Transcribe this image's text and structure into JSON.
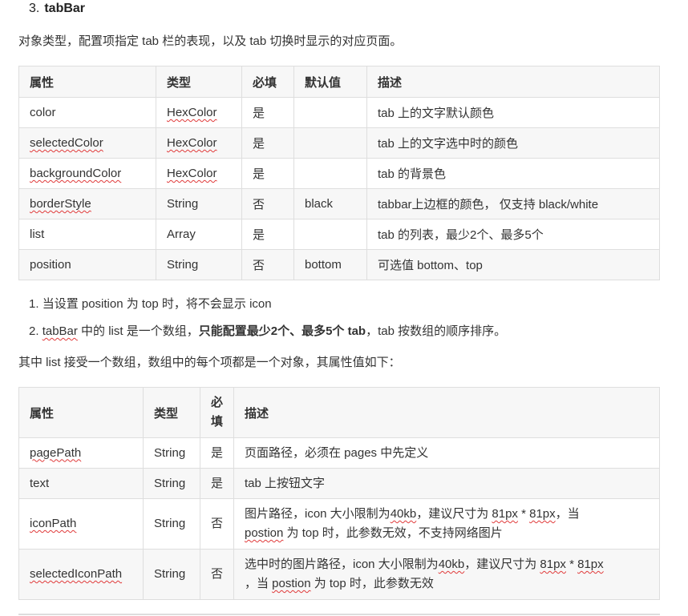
{
  "heading": {
    "number": "3.",
    "title": "tabBar"
  },
  "intro": "对象类型，配置项指定 tab 栏的表现，以及 tab 切换时显示的对应页面。",
  "table1": {
    "headers": [
      "属性",
      "类型",
      "必填",
      "默认值",
      "描述"
    ],
    "rows": [
      [
        "color",
        "HexColor",
        "是",
        "",
        "tab 上的文字默认颜色"
      ],
      [
        "selectedColor",
        "HexColor",
        "是",
        "",
        "tab 上的文字选中时的颜色"
      ],
      [
        "backgroundColor",
        "HexColor",
        "是",
        "",
        "tab 的背景色"
      ],
      [
        "borderStyle",
        "String",
        "否",
        "black",
        "tabbar上边框的颜色， 仅支持 black/white"
      ],
      [
        "list",
        "Array",
        "是",
        "",
        "tab 的列表，最少2个、最多5个"
      ],
      [
        "position",
        "String",
        "否",
        "bottom",
        "可选值 bottom、top"
      ]
    ]
  },
  "notes": {
    "n1_num": "1.",
    "n1": "当设置 position 为 top 时，将不会显示 icon",
    "n2_num": "2.",
    "n2_a": "tabBar",
    "n2_b": " 中的 list 是一个数组，",
    "n2_bold": "只能配置最少2个、最多5个 tab",
    "n2_c": "，tab 按数组的顺序排序。"
  },
  "para2": "其中 list 接受一个数组，数组中的每个项都是一个对象，其属性值如下：",
  "table2": {
    "headers": [
      "属性",
      "类型",
      "必",
      "填",
      "描述"
    ],
    "rows": [
      [
        "pagePath",
        "String",
        "是",
        "页面路径，必须在 pages 中先定义"
      ],
      [
        "text",
        "String",
        "是",
        "tab 上按钮文字"
      ],
      [
        "iconPath",
        "String",
        "否",
        "图片路径，icon 大小限制为",
        "40kb",
        "，建议尺寸为 ",
        "81px",
        " * ",
        "81px",
        "，当",
        "postion",
        " 为 top 时，此参数无效，不支持网络图片"
      ],
      [
        "selectedIconPath",
        "String",
        "否",
        "选中时的图片路径，icon 大小限制为",
        "40kb",
        "，建议尺寸为 ",
        "81px",
        " * ",
        "81px",
        "，当 ",
        "postion",
        " 为 top 时，此参数无效"
      ]
    ]
  }
}
